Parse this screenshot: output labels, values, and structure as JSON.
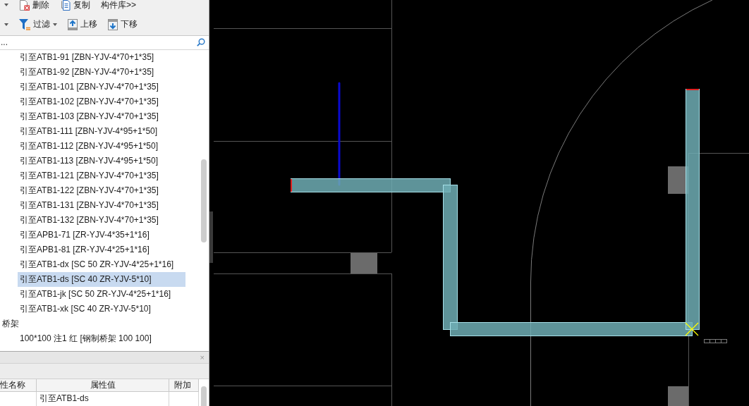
{
  "toolbar_rows": [
    {
      "items": [
        {
          "kind": "dropdown"
        },
        {
          "kind": "delete",
          "label": "删除"
        },
        {
          "kind": "copy",
          "label": "复制"
        },
        {
          "kind": "library",
          "label": "构件库>>"
        }
      ]
    },
    {
      "items": [
        {
          "kind": "dropdown"
        },
        {
          "kind": "filter",
          "label": "过滤"
        },
        {
          "kind": "move_up",
          "label": "上移"
        },
        {
          "kind": "move_down",
          "label": "下移"
        }
      ]
    }
  ],
  "search": {
    "value": "..."
  },
  "tree": [
    {
      "children": [
        {
          "label": "引至ATB1-91 [ZBN-YJV-4*70+1*35]",
          "selected": false
        },
        {
          "label": "引至ATB1-92 [ZBN-YJV-4*70+1*35]",
          "selected": false
        },
        {
          "label": "引至ATB1-101 [ZBN-YJV-4*70+1*35]",
          "selected": false
        },
        {
          "label": "引至ATB1-102 [ZBN-YJV-4*70+1*35]",
          "selected": false
        },
        {
          "label": "引至ATB1-103 [ZBN-YJV-4*70+1*35]",
          "selected": false
        },
        {
          "label": "引至ATB1-111 [ZBN-YJV-4*95+1*50]",
          "selected": false
        },
        {
          "label": "引至ATB1-112 [ZBN-YJV-4*95+1*50]",
          "selected": false
        },
        {
          "label": "引至ATB1-113 [ZBN-YJV-4*95+1*50]",
          "selected": false
        },
        {
          "label": "引至ATB1-121 [ZBN-YJV-4*70+1*35]",
          "selected": false
        },
        {
          "label": "引至ATB1-122 [ZBN-YJV-4*70+1*35]",
          "selected": false
        },
        {
          "label": "引至ATB1-131 [ZBN-YJV-4*70+1*35]",
          "selected": false
        },
        {
          "label": "引至ATB1-132 [ZBN-YJV-4*70+1*35]",
          "selected": false
        },
        {
          "label": "引至APB1-71 [ZR-YJV-4*35+1*16]",
          "selected": false
        },
        {
          "label": "引至APB1-81 [ZR-YJV-4*25+1*16]",
          "selected": false
        },
        {
          "label": "引至ATB1-dx [SC 50 ZR-YJV-4*25+1*16]",
          "selected": false
        },
        {
          "label": "引至ATB1-ds [SC 40 ZR-YJV-5*10]",
          "selected": true
        },
        {
          "label": "引至ATB1-jk [SC 50 ZR-YJV-4*25+1*16]",
          "selected": false
        },
        {
          "label": "引至ATB1-xk [SC 40 ZR-YJV-5*10]",
          "selected": false
        }
      ]
    },
    {
      "label": "桥架",
      "selected": false,
      "children": [
        {
          "label": "100*100 注1 红 [钢制桥架 100 100]",
          "selected": false
        }
      ]
    }
  ],
  "properties": {
    "close": "×",
    "columns": [
      "性名称",
      "属性值",
      "附加"
    ],
    "rows": [
      {
        "value": "引至ATB1-ds"
      }
    ]
  }
}
